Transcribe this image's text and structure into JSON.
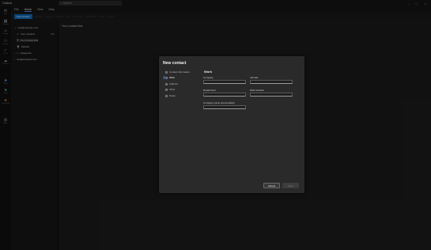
{
  "titlebar": {
    "app_name": "Outlook",
    "search_placeholder": "Search"
  },
  "menu": {
    "items": [
      "Home",
      "View",
      "Help"
    ],
    "items2": [
      "File",
      "Home",
      "View",
      "Help"
    ]
  },
  "toolbar": {
    "new_contact": "New contact"
  },
  "rail": {
    "items": [
      {
        "icon": "mail-icon",
        "label": "Mail"
      },
      {
        "icon": "calendar-icon",
        "label": "Calendar"
      },
      {
        "icon": "people-icon",
        "label": "People"
      },
      {
        "icon": "group-icon",
        "label": "Groups"
      },
      {
        "icon": "todo-icon",
        "label": "To Do"
      },
      {
        "icon": "onedrive-icon",
        "label": "OneDrive"
      },
      {
        "icon": "word-icon",
        "label": "Word"
      },
      {
        "icon": "excel-icon",
        "label": "Excel"
      },
      {
        "icon": "powerpoint-icon",
        "label": "PowerPoint"
      },
      {
        "icon": "apps-icon",
        "label": "Apps"
      }
    ]
  },
  "folders": {
    "account1": "test@example.com",
    "your_contacts": "Your contacts",
    "your_contacts_count": "285",
    "your_contact_lists": "Your contact lists",
    "deleted": "Deleted",
    "categories": "Categories",
    "account2": "test@example.com"
  },
  "main": {
    "header": "Your contact lists"
  },
  "dialog": {
    "title": "New contact",
    "nav": [
      {
        "icon": "contact-info-icon",
        "label": "Contact information",
        "active": false
      },
      {
        "icon": "work-icon",
        "label": "Work",
        "active": true
      },
      {
        "icon": "address-icon",
        "label": "Address",
        "active": false
      },
      {
        "icon": "other-icon",
        "label": "Other",
        "active": false
      },
      {
        "icon": "notes-icon",
        "label": "Notes",
        "active": false
      }
    ],
    "section_title": "Work",
    "fields": {
      "company": {
        "label": "Company",
        "value": ""
      },
      "job_title": {
        "label": "Job title",
        "value": ""
      },
      "department": {
        "label": "Department",
        "value": ""
      },
      "work_location": {
        "label": "Work location",
        "value": ""
      },
      "company_pronunciation": {
        "label": "Company name pronunciation",
        "value": ""
      }
    },
    "buttons": {
      "cancel": "Cancel",
      "save": "Save"
    }
  }
}
